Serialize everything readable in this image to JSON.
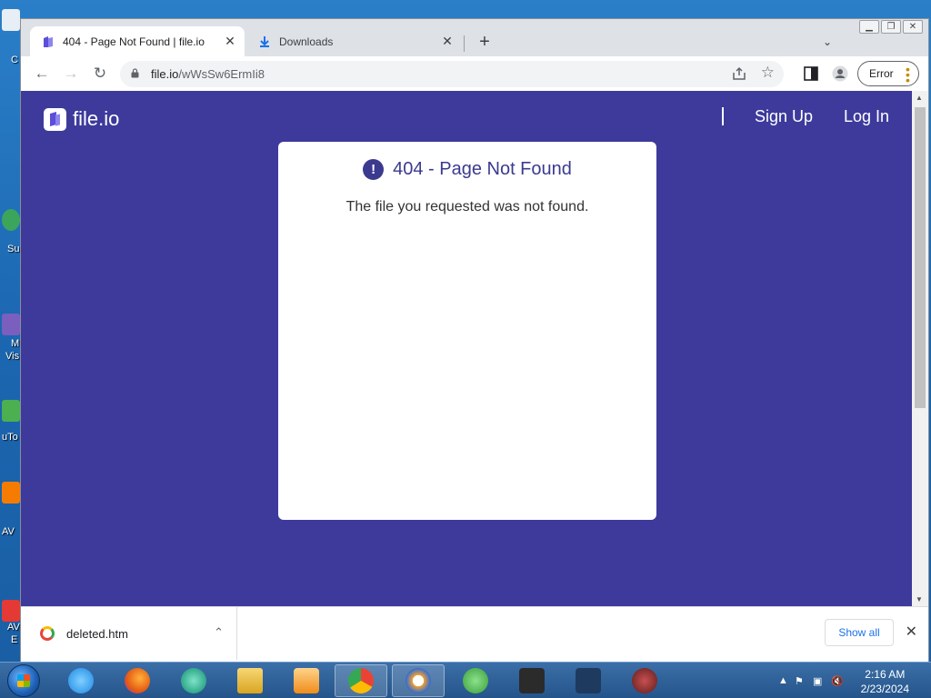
{
  "browser": {
    "tabs": [
      {
        "title": "404 - Page Not Found | file.io",
        "active": true
      },
      {
        "title": "Downloads",
        "active": false
      }
    ],
    "new_tab_label": "+",
    "url": {
      "host": "file.io",
      "path": "/wWsSw6ErmIi8"
    },
    "profile_status": "Error"
  },
  "page": {
    "logo_text": "file.io",
    "nav": {
      "sign_up": "Sign Up",
      "log_in": "Log In"
    },
    "error_card": {
      "title": "404 - Page Not Found",
      "message": "The file you requested was not found.",
      "alert_glyph": "!"
    },
    "colors": {
      "background": "#3d3a9c",
      "accent": "#3b3a8f",
      "card": "#ffffff"
    }
  },
  "download_bar": {
    "item_name": "deleted.htm",
    "show_all_label": "Show all"
  },
  "taskbar": {
    "clock_time": "2:16 AM",
    "clock_date": "2/23/2024",
    "apps": [
      "internet-explorer",
      "firefox",
      "app-globe",
      "file-explorer",
      "media-player",
      "chrome",
      "avast-browser",
      "utorrent",
      "world-of-tanks",
      "world-of-warships",
      "game-app"
    ]
  },
  "desktop_labels": [
    "C",
    "Su",
    "M",
    "Vis",
    "uTo",
    "AV",
    "AV",
    "E"
  ]
}
